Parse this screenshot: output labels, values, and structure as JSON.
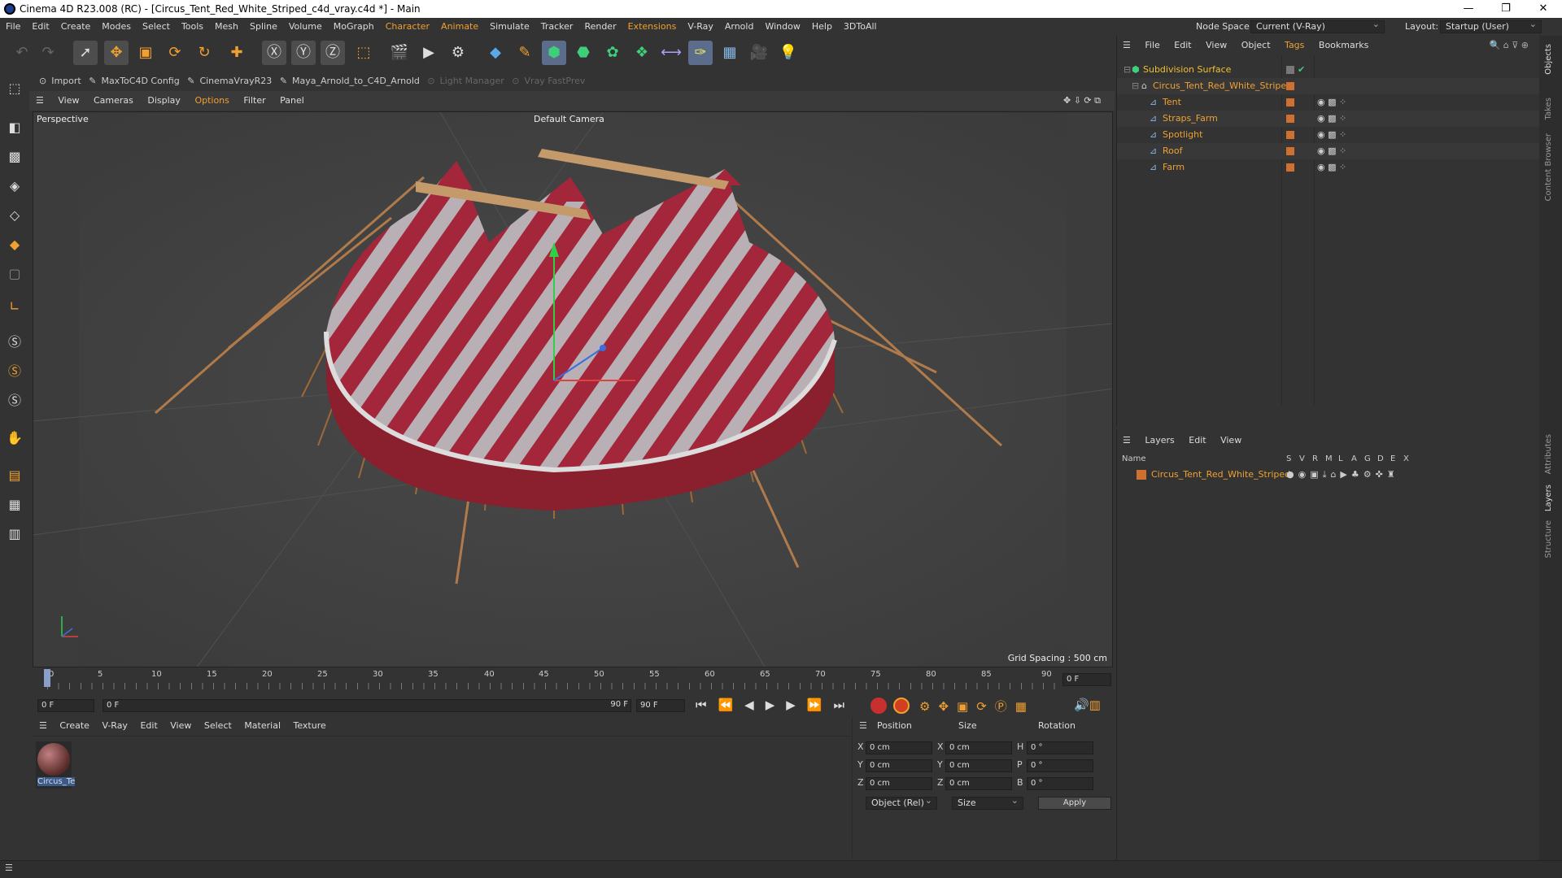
{
  "window": {
    "title": "Cinema 4D R23.008 (RC) - [Circus_Tent_Red_White_Striped_c4d_vray.c4d *] - Main"
  },
  "menu": [
    "File",
    "Edit",
    "Create",
    "Modes",
    "Select",
    "Tools",
    "Mesh",
    "Spline",
    "Volume",
    "MoGraph",
    "Character",
    "Animate",
    "Simulate",
    "Tracker",
    "Render",
    "Extensions",
    "V-Ray",
    "Arnold",
    "Window",
    "Help",
    "3DToAll"
  ],
  "node_space": {
    "label": "Node Space:",
    "value": "Current (V-Ray)"
  },
  "layout": {
    "label": "Layout:",
    "value": "Startup (User)"
  },
  "plugins": [
    "Import",
    "MaxToC4D Config",
    "CinemaVrayR23",
    "Maya_Arnold_to_C4D_Arnold",
    "Light Manager",
    "Vray FastPrev"
  ],
  "viewport_menu": [
    "View",
    "Cameras",
    "Display",
    "Options",
    "Filter",
    "Panel"
  ],
  "viewport": {
    "name": "Perspective",
    "camera": "Default Camera",
    "grid_spacing": "Grid Spacing : 500 cm"
  },
  "timeline": {
    "ticks": [
      "0",
      "5",
      "10",
      "15",
      "20",
      "25",
      "30",
      "35",
      "40",
      "45",
      "50",
      "55",
      "60",
      "65",
      "70",
      "75",
      "80",
      "85",
      "90"
    ],
    "current": "0 F",
    "start": "0 F",
    "range_start": "0 F",
    "range_end": "90 F",
    "end": "90 F"
  },
  "material_menu": [
    "Create",
    "V-Ray",
    "Edit",
    "View",
    "Select",
    "Material",
    "Texture"
  ],
  "material": {
    "name": "Circus_Te"
  },
  "coords": {
    "headers": [
      "Position",
      "Size",
      "Rotation"
    ],
    "rows": [
      {
        "axis": "X",
        "pos": "0 cm",
        "saxis": "X",
        "size": "0 cm",
        "raxis": "H",
        "rot": "0 °"
      },
      {
        "axis": "Y",
        "pos": "0 cm",
        "saxis": "Y",
        "size": "0 cm",
        "raxis": "P",
        "rot": "0 °"
      },
      {
        "axis": "Z",
        "pos": "0 cm",
        "sax": "Z",
        "sizes": "0 cm",
        "raxis": "B",
        "rot": "0 °"
      }
    ],
    "mode": "Object (Rel)",
    "size_mode": "Size",
    "apply": "Apply"
  },
  "objects_menu": [
    "File",
    "Edit",
    "View",
    "Object",
    "Tags",
    "Bookmarks"
  ],
  "objects": [
    {
      "name": "Subdivision Surface",
      "level": 0
    },
    {
      "name": "Circus_Tent_Red_White_Striped",
      "level": 1
    },
    {
      "name": "Tent",
      "level": 2
    },
    {
      "name": "Straps_Farm",
      "level": 2
    },
    {
      "name": "Spotlight",
      "level": 2
    },
    {
      "name": "Roof",
      "level": 2
    },
    {
      "name": "Farm",
      "level": 2
    }
  ],
  "layers_menu": [
    "Layers",
    "Edit",
    "View"
  ],
  "layers_header": {
    "name": "Name",
    "cols": [
      "S",
      "V",
      "R",
      "M",
      "L",
      "A",
      "G",
      "D",
      "E",
      "X"
    ]
  },
  "layers": [
    {
      "name": "Circus_Tent_Red_White_Striped"
    }
  ],
  "side_tabs": [
    "Objects",
    "Takes",
    "Content Browser",
    "Attributes",
    "Layers",
    "Structure"
  ],
  "colors": {
    "accent": "#f0a030",
    "tent_red": "#a3263a",
    "bg": "#333333"
  }
}
